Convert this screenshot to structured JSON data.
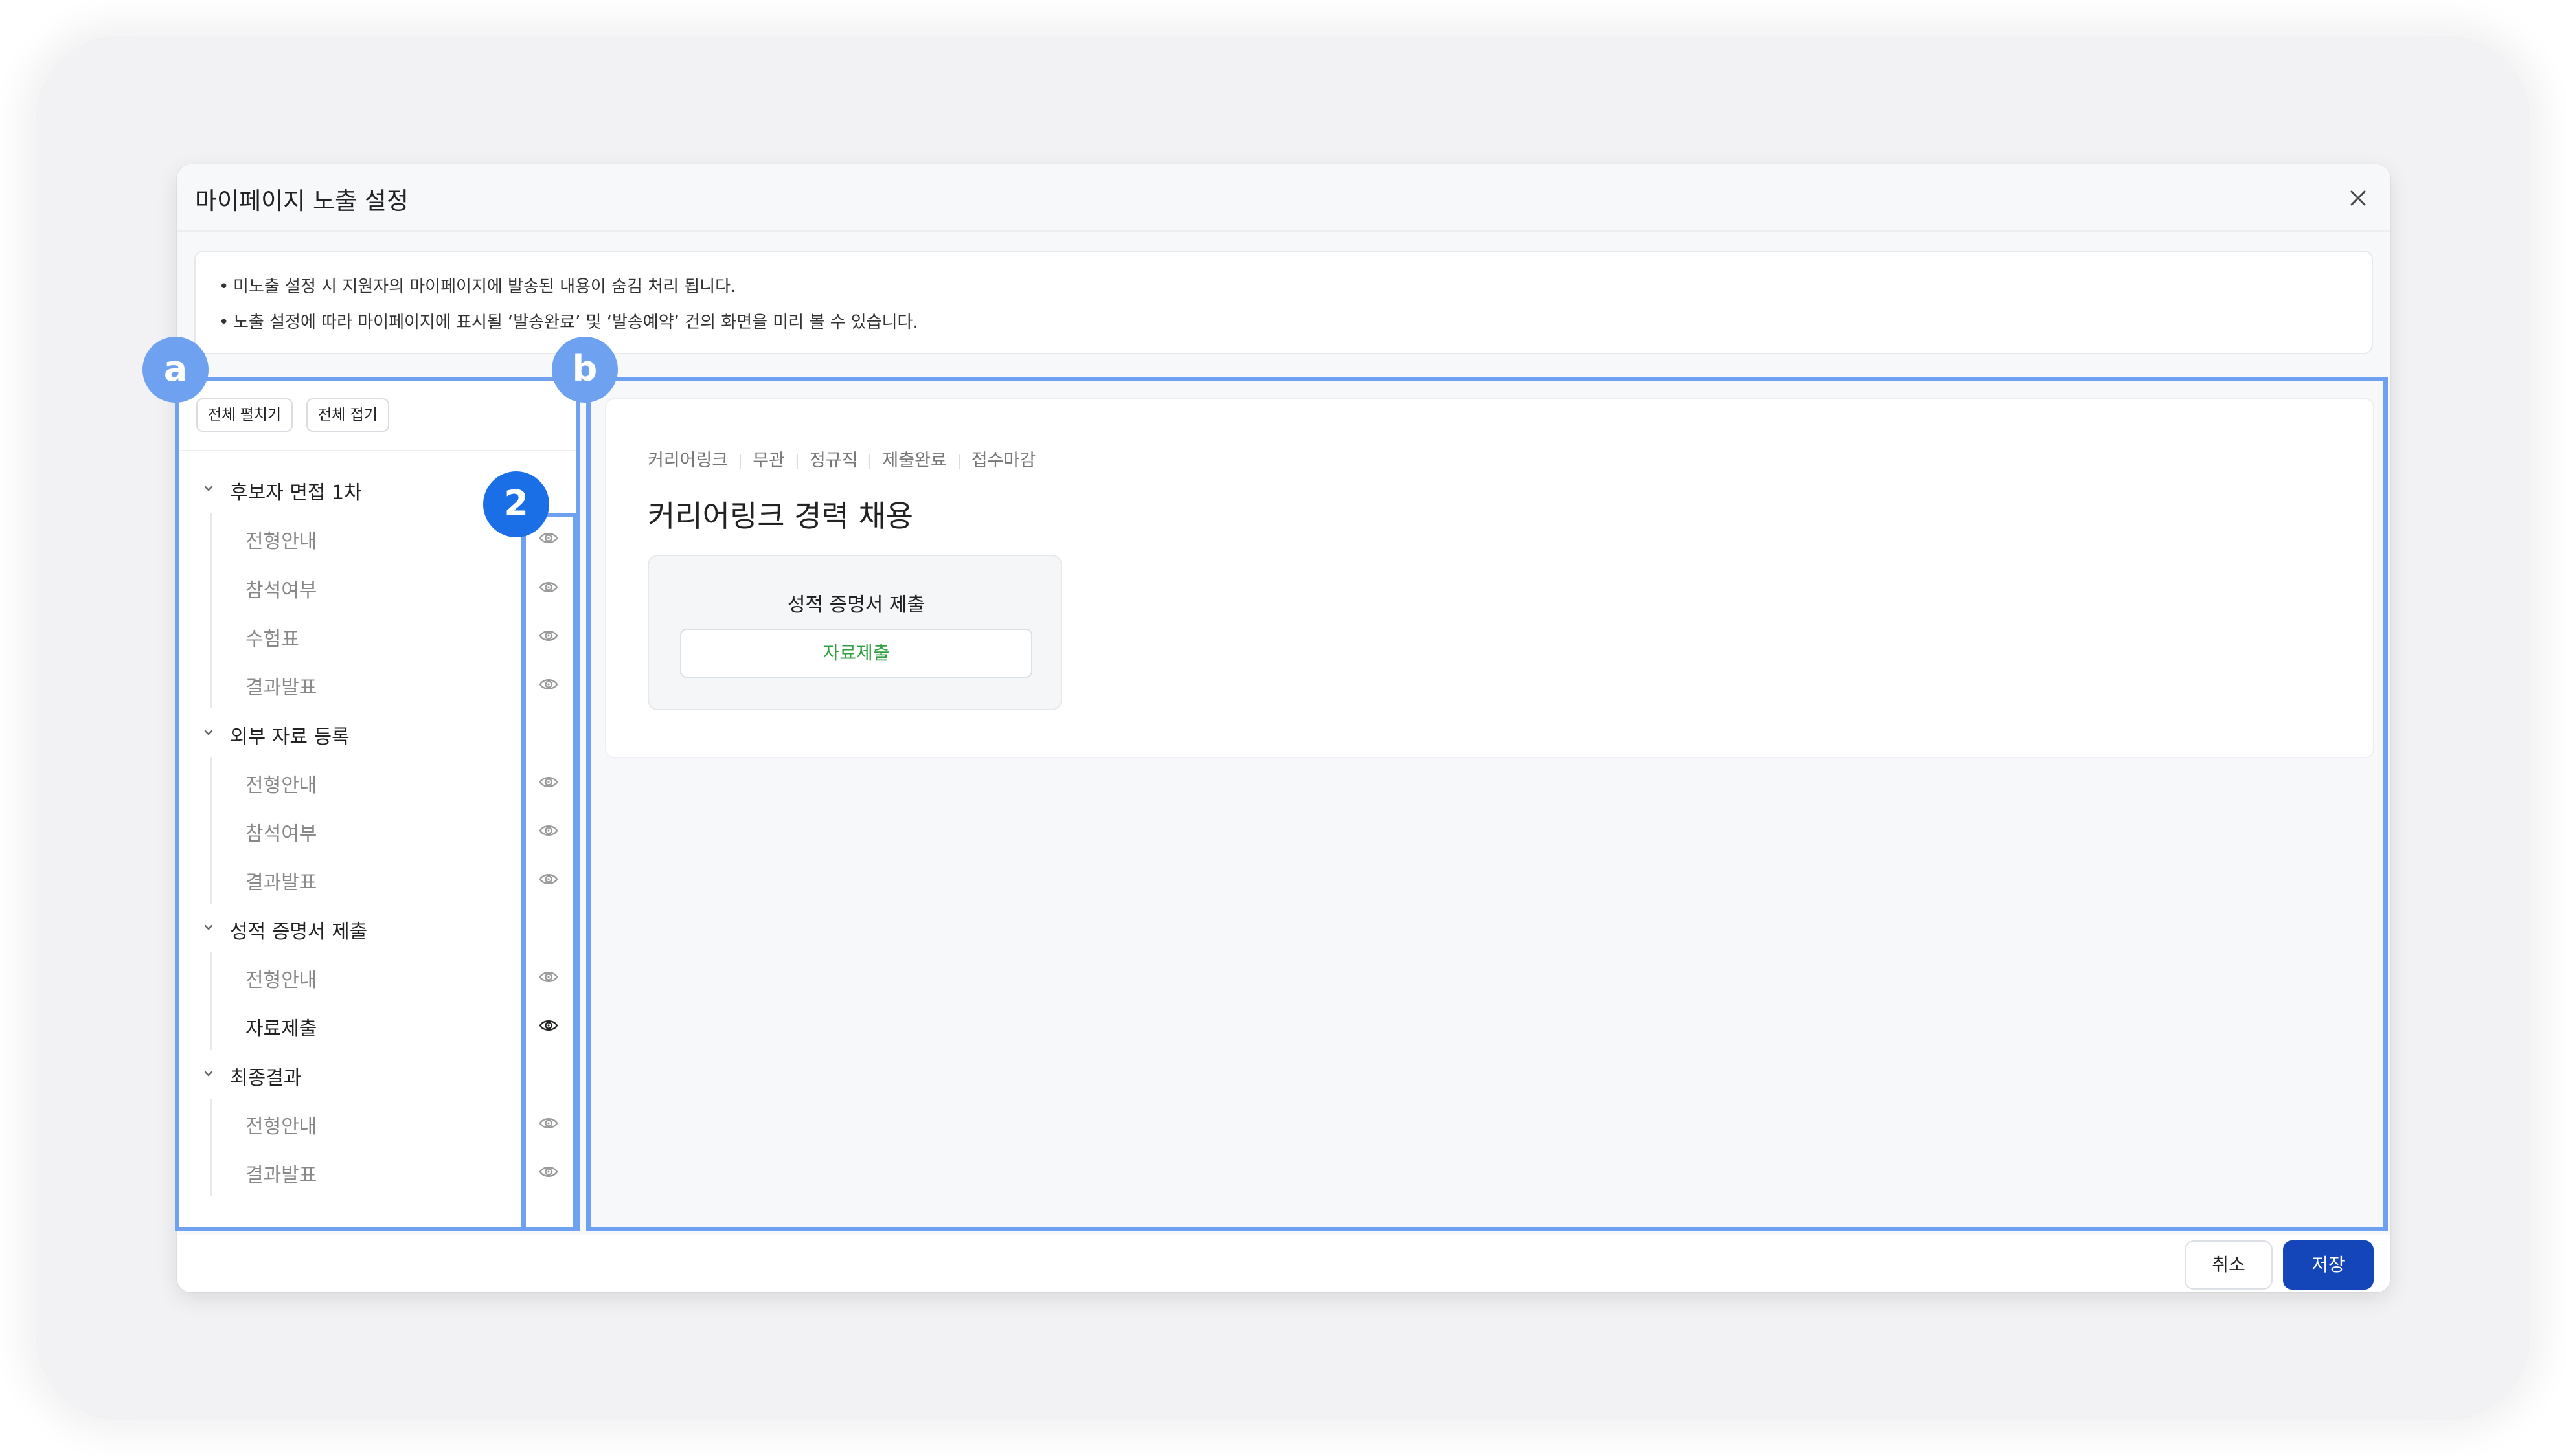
{
  "modal": {
    "title": "마이페이지 노출 설정",
    "notices": [
      "미노출 설정 시 지원자의 마이페이지에 발송된 내용이 숨김 처리 됩니다.",
      "노출 설정에 따라 마이페이지에 표시될 ‘발송완료’ 및 ‘발송예약’ 건의 화면을 미리 볼 수 있습니다."
    ]
  },
  "toolbar": {
    "expand_all": "전체 펼치기",
    "collapse_all": "전체 접기"
  },
  "tree": {
    "groups": [
      {
        "label": "후보자 면접 1차",
        "items": [
          {
            "label": "전형안내"
          },
          {
            "label": "참석여부"
          },
          {
            "label": "수험표"
          },
          {
            "label": "결과발표"
          }
        ]
      },
      {
        "label": "외부 자료 등록",
        "items": [
          {
            "label": "전형안내"
          },
          {
            "label": "참석여부"
          },
          {
            "label": "결과발표"
          }
        ]
      },
      {
        "label": "성적 증명서 제출",
        "items": [
          {
            "label": "전형안내"
          },
          {
            "label": "자료제출",
            "selected": true
          }
        ]
      },
      {
        "label": "최종결과",
        "items": [
          {
            "label": "전형안내"
          },
          {
            "label": "결과발표"
          }
        ]
      }
    ],
    "visibility_icon": "eye-icon"
  },
  "preview": {
    "breadcrumbs": [
      "커리어링크",
      "무관",
      "정규직",
      "제출완료",
      "접수마감"
    ],
    "title": "커리어링크 경력 채용",
    "step_title": "성적 증명서 제출",
    "submit_label": "자료제출"
  },
  "footer": {
    "cancel": "취소",
    "save": "저장"
  },
  "annotations": {
    "badge_a": "a",
    "badge_b": "b",
    "badge_2": "2"
  },
  "colors": {
    "highlight": "#6ea1ef",
    "badge_light": "#6ea1ef",
    "badge_dark": "#1a6ee6",
    "primary": "#1546b9",
    "success_text": "#2e9e3f"
  }
}
